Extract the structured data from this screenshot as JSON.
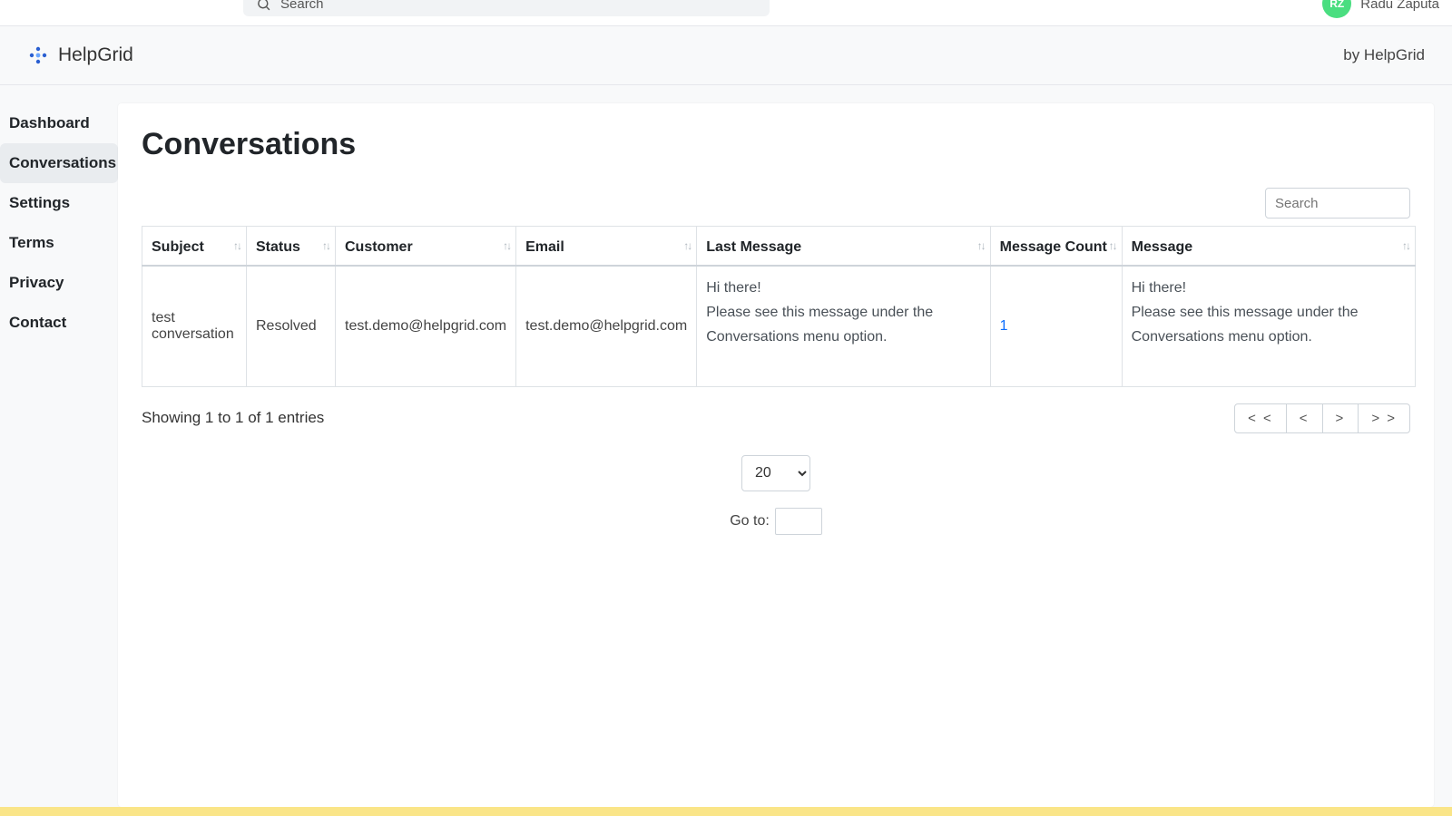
{
  "top": {
    "search_placeholder": "Search",
    "user_initials": "RZ",
    "user_name": "Radu Zaputa"
  },
  "brand": {
    "name": "HelpGrid",
    "byline": "by HelpGrid"
  },
  "sidebar": {
    "items": [
      {
        "label": "Dashboard",
        "active": false
      },
      {
        "label": "Conversations",
        "active": true
      },
      {
        "label": "Settings",
        "active": false
      },
      {
        "label": "Terms",
        "active": false
      },
      {
        "label": "Privacy",
        "active": false
      },
      {
        "label": "Contact",
        "active": false
      }
    ]
  },
  "page": {
    "title": "Conversations",
    "table_search_placeholder": "Search",
    "columns": [
      "Subject",
      "Status",
      "Customer",
      "Email",
      "Last Message",
      "Message Count",
      "Message"
    ],
    "rows": [
      {
        "subject": "test conversation",
        "status": "Resolved",
        "customer": "test.demo@helpgrid.com",
        "email": "test.demo@helpgrid.com",
        "last_message": "Hi there!\nPlease see this message under the Conversations menu option.",
        "message_count": "1",
        "message": "Hi there!\nPlease see this message under the Conversations menu option."
      }
    ],
    "entries_info": "Showing 1 to 1 of 1 entries",
    "pager": {
      "first": "< <",
      "prev": "<",
      "next": ">",
      "last": "> >"
    },
    "page_size": "20",
    "goto_label": "Go to:"
  }
}
